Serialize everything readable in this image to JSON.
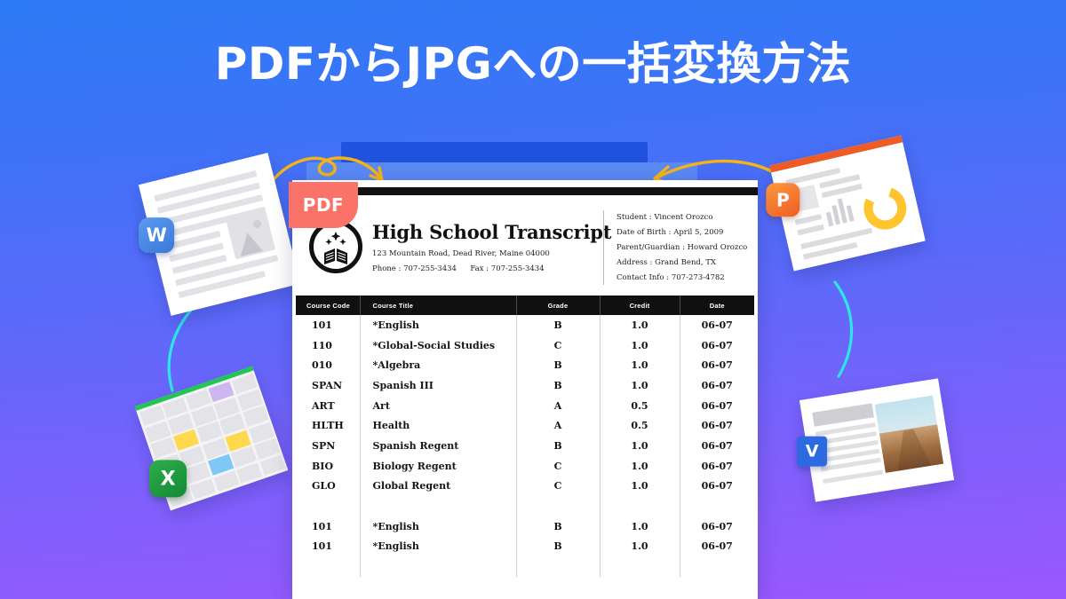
{
  "headline": "PDFからJPGへの一括変換方法",
  "colors": {
    "bg_top": "#2E7BF6",
    "bg_bottom": "#9B57FD",
    "pdf_badge": "#FA7268",
    "arrow": "#F5B416",
    "accent_cyan": "#2CE6E6",
    "word_blue": "#3B78D8",
    "excel_green": "#128A35",
    "ppt_orange": "#EF5B25",
    "visio_blue": "#2D6AE2",
    "table_header": "#101010"
  },
  "pdf_badge": {
    "label": "PDF"
  },
  "page_stack": {
    "layers": 2
  },
  "document": {
    "title": "High School Transcript",
    "logo_alt": "open-book-crest",
    "school": {
      "address": "123 Mountain Road, Dead River, Maine 04000",
      "phone_label": "Phone :",
      "phone": "707-255-3434",
      "fax_label": "Fax :",
      "fax": "707-255-3434"
    },
    "student_info": [
      {
        "label": "Student",
        "value": "Vincent Orozco"
      },
      {
        "label": "Date of Birth",
        "value": "April 5,  2009"
      },
      {
        "label": "Parent/Guardian",
        "value": "Howard Orozco"
      },
      {
        "label": "Address",
        "value": "Grand Bend, TX"
      },
      {
        "label": "Contact Info",
        "value": "707-273-4782"
      }
    ],
    "table": {
      "columns": [
        "Course Code",
        "Course Title",
        "Grade",
        "Credit",
        "Date"
      ],
      "rows": [
        [
          "101",
          "*English",
          "B",
          "1.0",
          "06-07"
        ],
        [
          "110",
          "*Global-Social Studies",
          "C",
          "1.0",
          "06-07"
        ],
        [
          "010",
          "*Algebra",
          "B",
          "1.0",
          "06-07"
        ],
        [
          "SPAN",
          "Spanish III",
          "B",
          "1.0",
          "06-07"
        ],
        [
          "ART",
          "Art",
          "A",
          "0.5",
          "06-07"
        ],
        [
          "HLTH",
          "Health",
          "A",
          "0.5",
          "06-07"
        ],
        [
          "SPN",
          "Spanish Regent",
          "B",
          "1.0",
          "06-07"
        ],
        [
          "BIO",
          "Biology Regent",
          "C",
          "1.0",
          "06-07"
        ],
        [
          "GLO",
          "Global Regent",
          "C",
          "1.0",
          "06-07"
        ]
      ],
      "rows_after_gap": [
        [
          "101",
          "*English",
          "B",
          "1.0",
          "06-07"
        ],
        [
          "101",
          "*English",
          "B",
          "1.0",
          "06-07"
        ]
      ]
    }
  },
  "file_cards": [
    {
      "id": "word",
      "badge": "W",
      "name": "word-document-icon"
    },
    {
      "id": "excel",
      "badge": "X",
      "name": "excel-spreadsheet-icon"
    },
    {
      "id": "ppt",
      "badge": "P",
      "name": "powerpoint-slide-icon"
    },
    {
      "id": "visio",
      "badge": "V",
      "name": "visio-document-icon"
    }
  ],
  "arrows": [
    {
      "id": "left-arrow",
      "direction": "right-down"
    },
    {
      "id": "right-arrow",
      "direction": "left-down"
    }
  ]
}
